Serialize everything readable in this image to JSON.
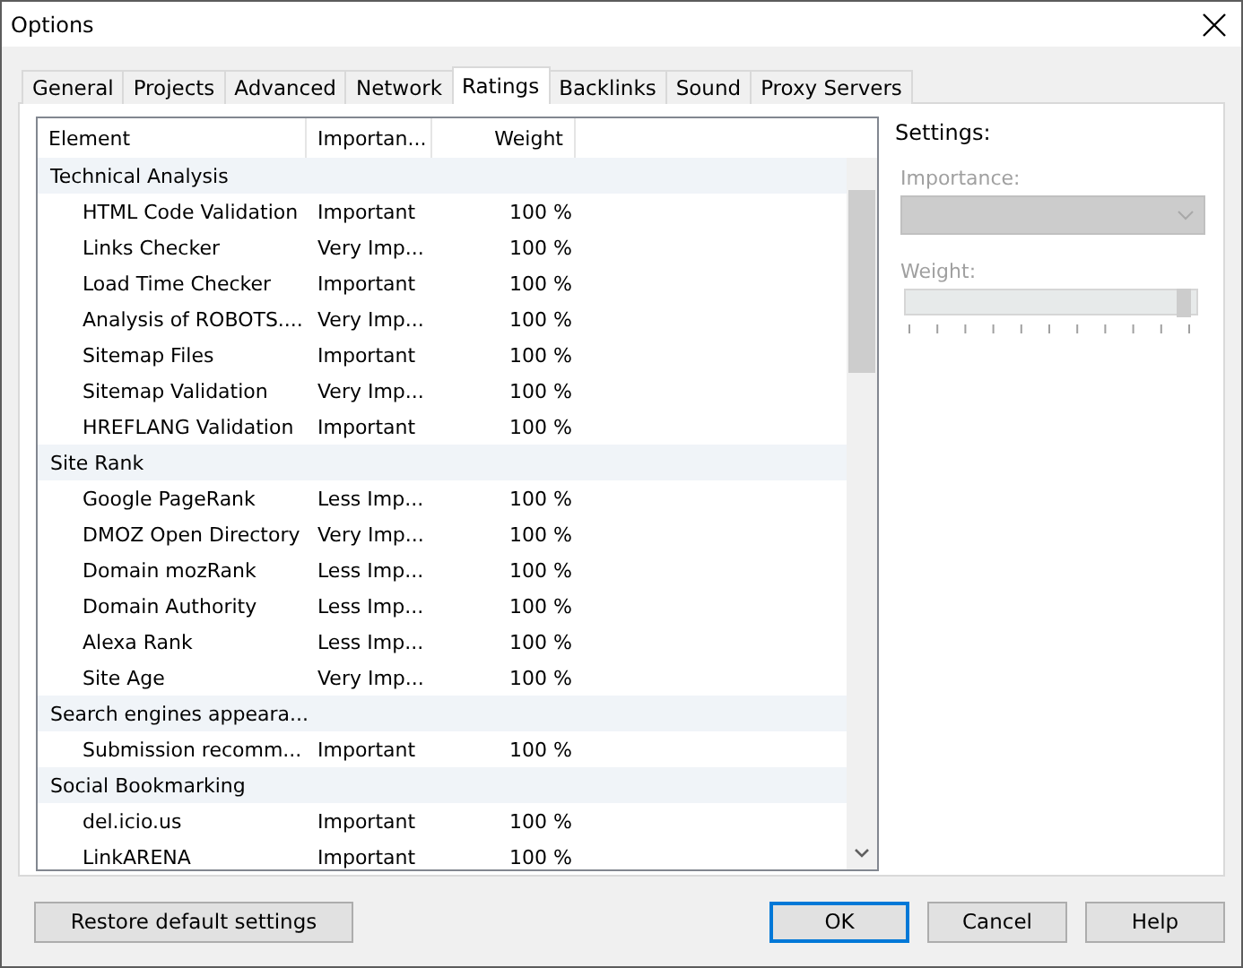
{
  "window": {
    "title": "Options"
  },
  "tabs": [
    {
      "label": "General",
      "selected": false
    },
    {
      "label": "Projects",
      "selected": false
    },
    {
      "label": "Advanced",
      "selected": false
    },
    {
      "label": "Network",
      "selected": false
    },
    {
      "label": "Ratings",
      "selected": true
    },
    {
      "label": "Backlinks",
      "selected": false
    },
    {
      "label": "Sound",
      "selected": false
    },
    {
      "label": "Proxy Servers",
      "selected": false
    }
  ],
  "table": {
    "columns": [
      "Element",
      "Importan...",
      "Weight"
    ],
    "groups": [
      {
        "name": "Technical Analysis",
        "children": [
          {
            "element": "HTML Code Validation",
            "importance": "Important",
            "weight": "100 %"
          },
          {
            "element": "Links Checker",
            "importance": "Very Imp...",
            "weight": "100 %"
          },
          {
            "element": "Load Time Checker",
            "importance": "Important",
            "weight": "100 %"
          },
          {
            "element": "Analysis of ROBOTS....",
            "importance": "Very Imp...",
            "weight": "100 %"
          },
          {
            "element": "Sitemap Files",
            "importance": "Important",
            "weight": "100 %"
          },
          {
            "element": "Sitemap Validation",
            "importance": "Very Imp...",
            "weight": "100 %"
          },
          {
            "element": "HREFLANG Validation",
            "importance": "Important",
            "weight": "100 %"
          }
        ]
      },
      {
        "name": "Site Rank",
        "children": [
          {
            "element": "Google PageRank",
            "importance": "Less Imp...",
            "weight": "100 %"
          },
          {
            "element": "DMOZ Open Directory",
            "importance": "Very Imp...",
            "weight": "100 %"
          },
          {
            "element": "Domain mozRank",
            "importance": "Less Imp...",
            "weight": "100 %"
          },
          {
            "element": "Domain Authority",
            "importance": "Less Imp...",
            "weight": "100 %"
          },
          {
            "element": "Alexa Rank",
            "importance": "Less Imp...",
            "weight": "100 %"
          },
          {
            "element": "Site Age",
            "importance": "Very Imp...",
            "weight": "100 %"
          }
        ]
      },
      {
        "name": "Search engines appeara...",
        "children": [
          {
            "element": "Submission recomm...",
            "importance": "Important",
            "weight": "100 %"
          }
        ]
      },
      {
        "name": "Social Bookmarking",
        "children": [
          {
            "element": "del.icio.us",
            "importance": "Important",
            "weight": "100 %"
          },
          {
            "element": "LinkARENA",
            "importance": "Important",
            "weight": "100 %"
          }
        ]
      }
    ]
  },
  "settings": {
    "title": "Settings:",
    "disabled": true,
    "importance_label": "Importance:",
    "weight_label": "Weight:",
    "weight": {
      "level": 0.98
    }
  },
  "buttons": [
    {
      "label": "Restore default settings",
      "focused": false
    },
    {
      "label": "OK",
      "focused": true
    },
    {
      "label": "Cancel",
      "focused": false
    },
    {
      "label": "Help",
      "focused": false
    }
  ]
}
